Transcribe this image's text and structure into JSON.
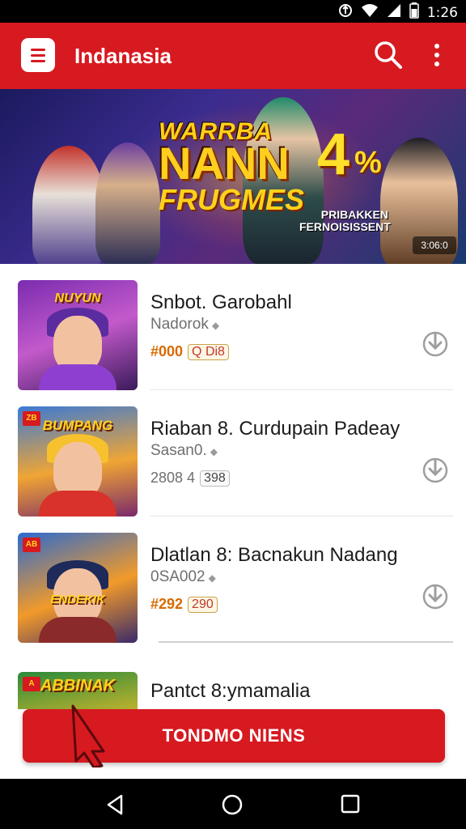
{
  "status_bar": {
    "time": "1:26",
    "icons": [
      "usb-icon",
      "wifi-icon",
      "signal-icon",
      "battery-icon"
    ]
  },
  "app_bar": {
    "title": "Indanasia",
    "menu_icon": "menu-icon",
    "search_icon": "search-icon",
    "more_icon": "more-vert-icon",
    "color": "#d71920"
  },
  "banner": {
    "line1": "WARRBA",
    "line2": "NANN",
    "line3": "FRUGMES",
    "number": "4",
    "number_suffix": "%",
    "subtitle_line1": "PRIBAKKEN",
    "subtitle_line2": "FERNOISISSENT",
    "badge": "3:06:0"
  },
  "games": [
    {
      "title": "Snbot. Garobahl",
      "subtitle": "Nadorok",
      "price": "#000",
      "badge": "Q Di8",
      "thumb_label": "NUYUN",
      "thumb_tag": ""
    },
    {
      "title": "Riaban 8. Curdupain Padeay",
      "subtitle": "Sasan0.",
      "price": "2808 4",
      "badge": "398",
      "thumb_label": "BUMPANG",
      "thumb_tag": "ZB"
    },
    {
      "title": "Dlatlan 8: Bacnakun Nadang",
      "subtitle": "0SA002",
      "price": "#292",
      "badge": "290",
      "thumb_label": "ENDEKIK",
      "thumb_tag": "AB"
    },
    {
      "title": "Pantct 8:ymamalia",
      "subtitle": "",
      "price": "",
      "badge": "",
      "thumb_label": "ABBINAK",
      "thumb_tag": "A"
    }
  ],
  "cta": {
    "label": "TONDMO NIENS",
    "color": "#d71920"
  },
  "nav_bar": {
    "back_icon": "back-icon",
    "home_icon": "home-icon",
    "recent_icon": "recent-apps-icon"
  }
}
